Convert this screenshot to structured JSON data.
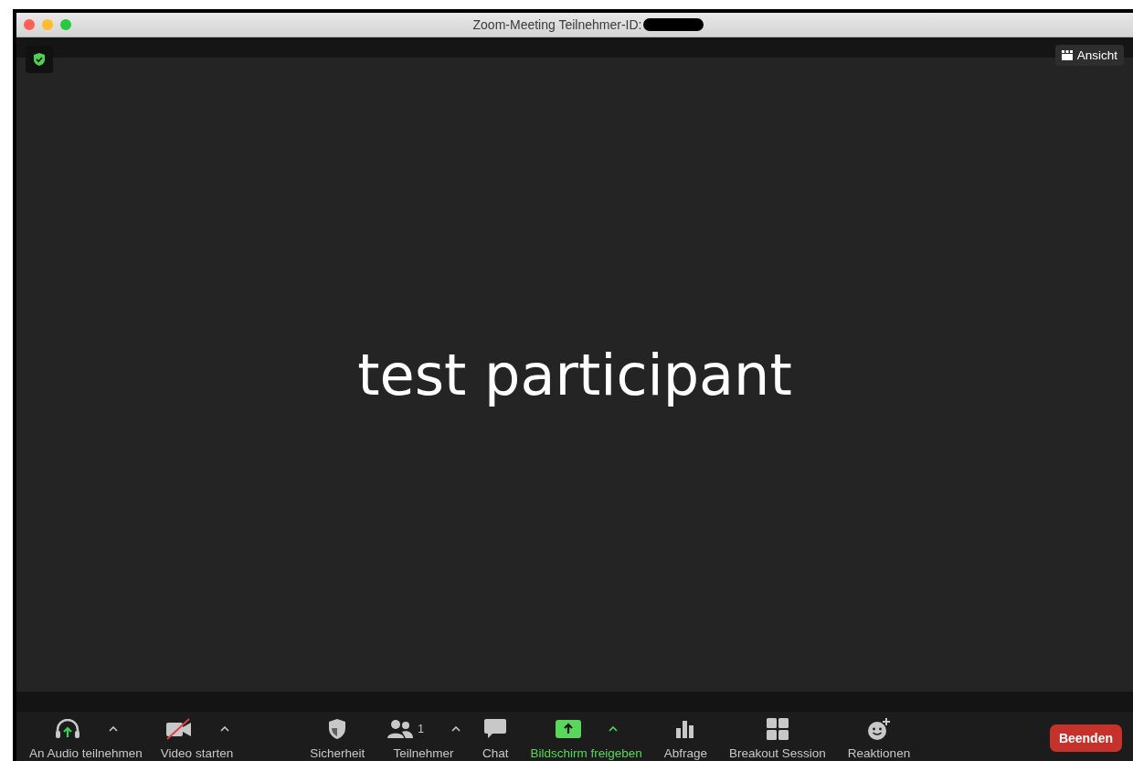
{
  "window": {
    "title": "Zoom-Meeting Teilnehmer-ID:",
    "id_redacted": true
  },
  "meeting": {
    "secure": true,
    "view_button": "Ansicht",
    "participant_name": "test participant"
  },
  "toolbar": {
    "left": [
      {
        "kind": "audio",
        "label": "An Audio teilnehmen",
        "has_menu": true,
        "accent": false
      },
      {
        "kind": "video",
        "label": "Video starten",
        "has_menu": true,
        "accent": false
      }
    ],
    "center": [
      {
        "kind": "security",
        "label": "Sicherheit",
        "has_menu": false,
        "accent": false
      },
      {
        "kind": "participants",
        "label": "Teilnehmer",
        "count": "1",
        "has_menu": true,
        "accent": false
      },
      {
        "kind": "chat",
        "label": "Chat",
        "has_menu": false,
        "accent": false
      },
      {
        "kind": "share",
        "label": "Bildschirm freigeben",
        "has_menu": true,
        "accent": true
      },
      {
        "kind": "poll",
        "label": "Abfrage",
        "has_menu": false,
        "accent": false
      },
      {
        "kind": "breakout",
        "label": "Breakout Session",
        "has_menu": false,
        "accent": false
      },
      {
        "kind": "reactions",
        "label": "Reaktionen",
        "has_menu": false,
        "accent": false
      }
    ],
    "end_button": "Beenden"
  }
}
